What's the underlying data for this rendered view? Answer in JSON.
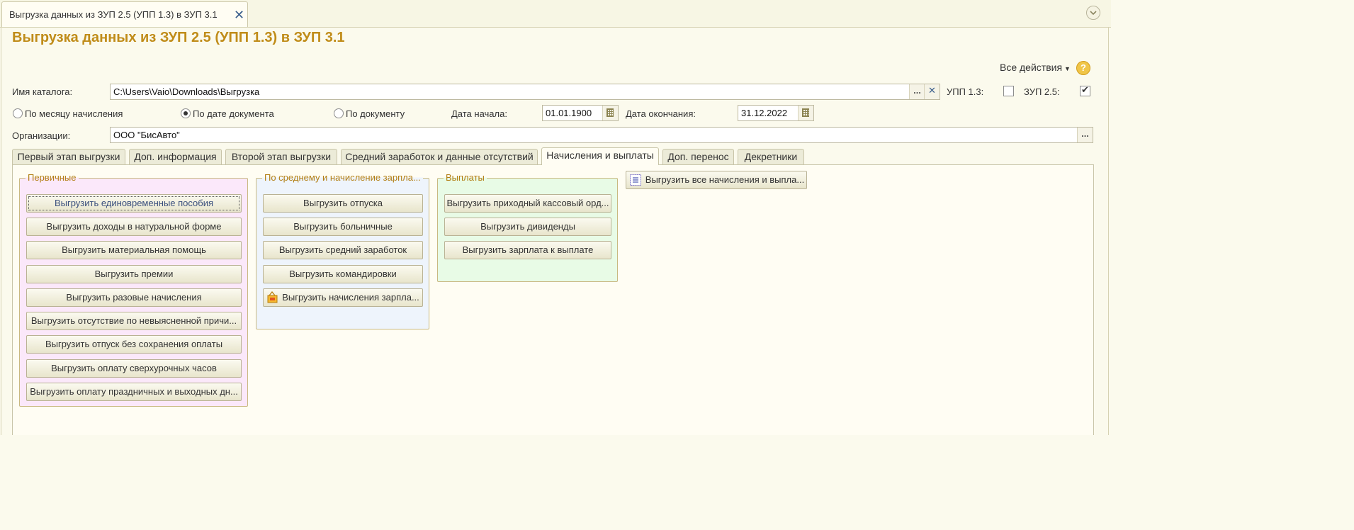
{
  "window": {
    "tab_title": "Выгрузка данных из ЗУП 2.5 (УПП 1.3) в ЗУП 3.1",
    "close_glyph": "✕"
  },
  "header": {
    "title": "Выгрузка данных из ЗУП 2.5 (УПП 1.3) в ЗУП 3.1",
    "all_actions": "Все действия",
    "help": "?"
  },
  "form": {
    "catalog_label": "Имя каталога:",
    "catalog_value": "C:\\Users\\Vaio\\Downloads\\Выгрузка",
    "upp_label": "УПП 1.3:",
    "upp_checked": false,
    "zup_label": "ЗУП 2.5:",
    "zup_checked": true,
    "radio_month": "По месяцу начисления",
    "radio_date": "По дате документа",
    "radio_doc": "По документу",
    "selected_mode": "По дате документа",
    "date_start_label": "Дата начала:",
    "date_start": "01.01.1900",
    "date_end_label": "Дата окончания:",
    "date_end": "31.12.2022",
    "org_label": "Организации:",
    "org_value": "ООО \"БисАвто\"",
    "ellipsis": "...",
    "clear": "✕"
  },
  "tabs": [
    "Первый этап выгрузки",
    "Доп. информация",
    "Второй этап выгрузки",
    "Средний заработок и данные отсутствий",
    "Начисления и выплаты",
    "Доп. перенос",
    "Декретники"
  ],
  "active_tab": "Начисления и выплаты",
  "groups": {
    "primary": {
      "title": "Первичные",
      "buttons": [
        "Выгрузить единовременные пособия",
        "Выгрузить доходы в натуральной форме",
        "Выгрузить материальная помощь",
        "Выгрузить премии",
        "Выгрузить разовые начисления",
        "Выгрузить отсутствие по невыясненной причи...",
        "Выгрузить отпуск без сохранения оплаты",
        "Выгрузить оплату сверхурочных часов",
        "Выгрузить оплату праздничных и выходных дн..."
      ]
    },
    "average": {
      "title": "По среднему и начисление зарпла...",
      "buttons": [
        "Выгрузить отпуска",
        "Выгрузить больничные",
        "Выгрузить средний заработок",
        "Выгрузить командировки",
        "Выгрузить начисления зарпла..."
      ]
    },
    "payments": {
      "title": "Выплаты",
      "buttons": [
        "Выгрузить приходный кассовый орд...",
        "Выгрузить дивиденды",
        "Выгрузить зарплата к выплате"
      ]
    }
  },
  "export_all_button": "Выгрузить все начисления и выпла...",
  "colors": {
    "title": "#c08c19",
    "group_primary_bg": "#fbe8fa",
    "group_average_bg": "#eef4fc",
    "group_payments_bg": "#e8fbe6"
  }
}
